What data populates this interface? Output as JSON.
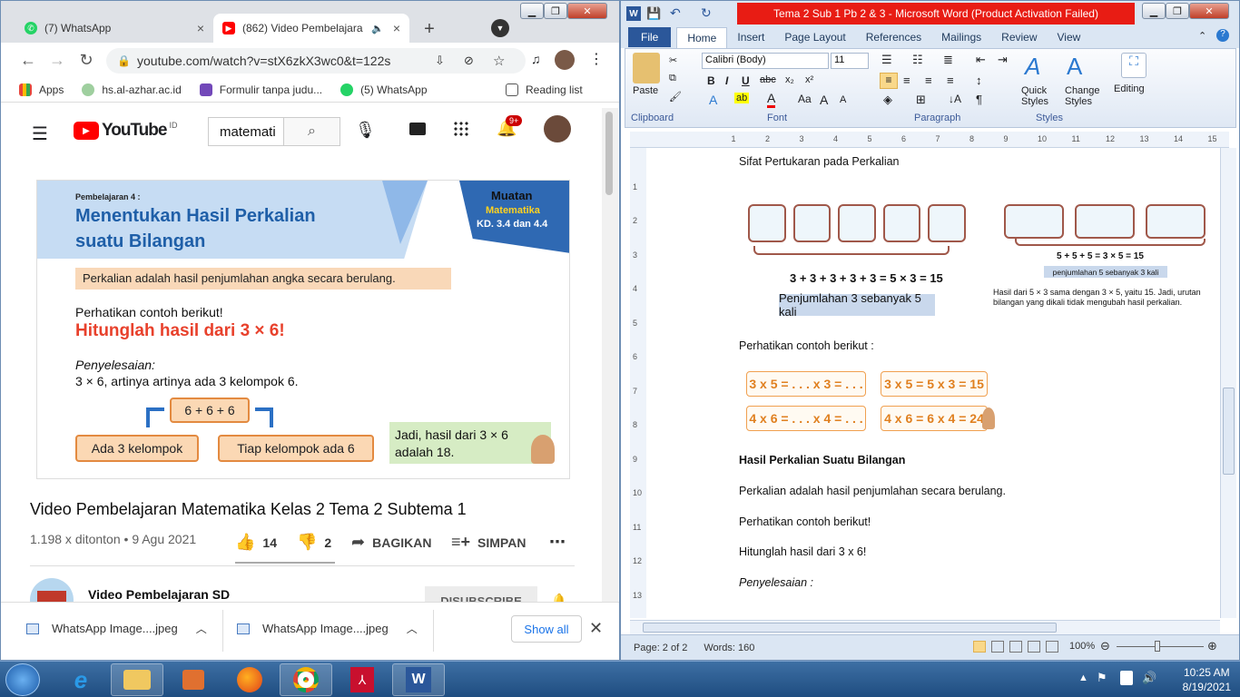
{
  "chrome": {
    "tabs": [
      {
        "label": "(7) WhatsApp"
      },
      {
        "label": "(862) Video Pembelajara"
      }
    ],
    "url": "youtube.com/watch?v=stX6zkX3wc0&t=122s",
    "bookmarks": [
      {
        "label": "Apps"
      },
      {
        "label": "hs.al-azhar.ac.id"
      },
      {
        "label": "Formulir tanpa judu..."
      },
      {
        "label": "(5) WhatsApp"
      }
    ],
    "reading_list": "Reading list"
  },
  "youtube": {
    "logo_text": "YouTube",
    "logo_suffix": "ID",
    "search_value": "matemati",
    "notif_count": "9+",
    "video_title": "Video Pembelajaran Matematika Kelas 2 Tema 2 Subtema 1",
    "views": "1.198 x ditonton • 9 Agu 2021",
    "likes": "14",
    "dislikes": "2",
    "share": "BAGIKAN",
    "save": "SIMPAN",
    "channel": "Video Pembelajaran SD",
    "subscribe": "DISUBSCRIBE"
  },
  "video_frame": {
    "lesson": "Pembelajaran 4 :",
    "title_line1": "Menentukan Hasil Perkalian",
    "title_line2": "suatu Bilangan",
    "muatan": "Muatan",
    "mapel": "Matematika",
    "kd": "KD. 3.4 dan 4.4",
    "definition": "Perkalian adalah hasil penjumlahan angka secara berulang.",
    "example_intro": "Perhatikan contoh berikut!",
    "question": "Hitunglah hasil dari 3 × 6!",
    "solution_label": "Penyelesaian:",
    "solution_text": "3 × 6, artinya artinya ada 3 kelompok 6.",
    "sum_box": "6 + 6 + 6",
    "groups_box": "Ada 3 kelompok",
    "each_box": "Tiap kelompok ada 6",
    "conclusion": "Jadi, hasil dari 3 × 6 adalah 18."
  },
  "downloads": [
    {
      "label": "WhatsApp Image....jpeg"
    },
    {
      "label": "WhatsApp Image....jpeg"
    }
  ],
  "show_all": "Show all",
  "word": {
    "title": "Tema 2 Sub 1 Pb 2 & 3  -  Microsoft Word (Product Activation Failed)",
    "tabs": [
      "File",
      "Home",
      "Insert",
      "Page Layout",
      "References",
      "Mailings",
      "Review",
      "View"
    ],
    "font_name": "Calibri (Body)",
    "font_size": "11",
    "groups": {
      "clipboard": "Clipboard",
      "font": "Font",
      "paragraph": "Paragraph",
      "styles": "Styles"
    },
    "paste": "Paste",
    "quick_styles": "Quick Styles",
    "change_styles": "Change Styles",
    "editing": "Editing",
    "doc": {
      "heading1": "Sifat Pertukaran pada Perkalian",
      "eq_left": "3 + 3 + 3 + 3 + 3 = 5 × 3 = 15",
      "caption_left": "Penjumlahan 3 sebanyak 5 kali",
      "eq_right": "5 + 5 + 5 = 3 × 5 = 15",
      "caption_right": "penjumlahan 5 sebanyak 3 kali",
      "note": "Hasil dari 5 × 3 sama dengan 3 × 5, yaitu 15. Jadi, urutan bilangan yang dikali tidak mengubah hasil perkalian.",
      "example_intro": "Perhatikan contoh berikut :",
      "ex1": "3 x 5 = . . . x 3 = . . .",
      "ex2": "3 x 5 = 5 x 3 = 15",
      "ex3": "4 x 6 = . . . x 4 = . . .",
      "ex4": "4 x 6 = 6 x 4 = 24",
      "heading2": "Hasil Perkalian Suatu Bilangan",
      "p1": "Perkalian adalah  hasil penjumlahan secara berulang.",
      "p2": "Perhatikan contoh berikut!",
      "p3": "Hitunglah hasil dari 3 x 6!",
      "p4": "Penyelesaian :"
    },
    "status_page": "Page: 2 of 2",
    "status_words": "Words: 160",
    "zoom": "100%"
  },
  "taskbar": {
    "time": "10:25 AM",
    "date": "8/19/2021"
  },
  "colors": {
    "yt_red": "#ff0000",
    "word_blue": "#2b579a",
    "title_red": "#e81c14",
    "lesson_blue": "#1f5fa8",
    "question_red": "#e8412c"
  }
}
